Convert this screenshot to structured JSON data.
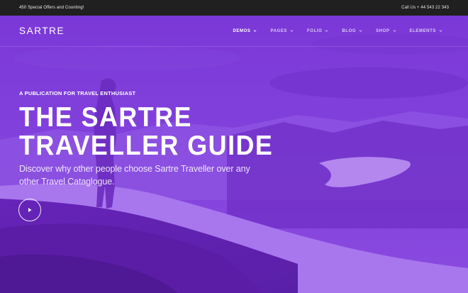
{
  "topbar": {
    "offer_text": "450 Special Offers and Counting!",
    "contact_text": "Call Us + 44 543 22 343"
  },
  "header": {
    "logo": "SARTRE",
    "menu": [
      {
        "label": "DEMOS",
        "active": true
      },
      {
        "label": "PAGES",
        "active": false
      },
      {
        "label": "FOLIO",
        "active": false
      },
      {
        "label": "BLOG",
        "active": false
      },
      {
        "label": "SHOP",
        "active": false
      },
      {
        "label": "ELEMENTS",
        "active": false
      }
    ]
  },
  "hero": {
    "kicker": "A PUBLICATION FOR TRAVEL ENTHUSIAST",
    "headline_line1": "THE SARTRE",
    "headline_line2": "TRAVELLER GUIDE",
    "subtitle": "Discover why other people choose Sartre Traveller over any other Travel Cataglogue.",
    "overlay_color": "#7a35d6",
    "play_icon": "play-icon"
  }
}
